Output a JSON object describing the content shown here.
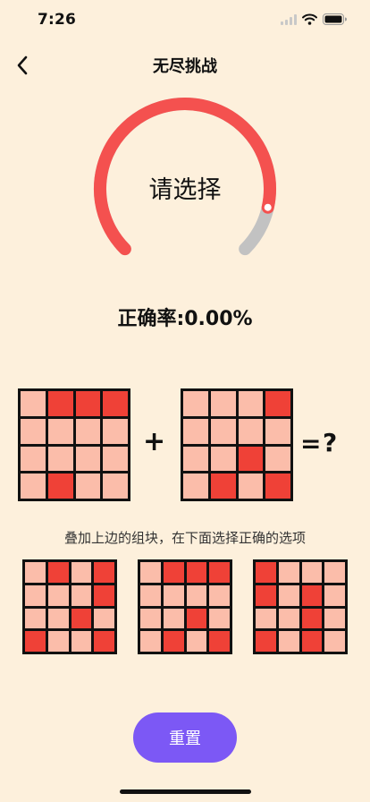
{
  "status_bar": {
    "time": "7:26",
    "icons": [
      "signal-icon",
      "wifi-icon",
      "battery-icon"
    ]
  },
  "nav": {
    "title": "无尽挑战",
    "back_icon": "chevron-left-icon"
  },
  "gauge": {
    "label": "请选择",
    "progress": 0.88,
    "colors": {
      "active": "#f4514f",
      "track": "#c2c2c2"
    }
  },
  "accuracy": {
    "text": "正确率:0.00%"
  },
  "puzzle": {
    "operand_a": [
      [
        0,
        1,
        1,
        1
      ],
      [
        0,
        0,
        0,
        0
      ],
      [
        0,
        0,
        0,
        0
      ],
      [
        0,
        1,
        0,
        0
      ]
    ],
    "plus": "+",
    "operand_b": [
      [
        0,
        0,
        0,
        1
      ],
      [
        0,
        0,
        0,
        0
      ],
      [
        0,
        0,
        1,
        0
      ],
      [
        0,
        1,
        0,
        1
      ]
    ],
    "equals": "=",
    "question": "?"
  },
  "hint": "叠加上边的组块，在下面选择正确的选项",
  "options": [
    [
      [
        0,
        1,
        0,
        1
      ],
      [
        0,
        0,
        0,
        1
      ],
      [
        0,
        0,
        1,
        0
      ],
      [
        1,
        0,
        0,
        1
      ]
    ],
    [
      [
        0,
        1,
        1,
        1
      ],
      [
        0,
        0,
        0,
        0
      ],
      [
        0,
        0,
        1,
        0
      ],
      [
        0,
        1,
        0,
        1
      ]
    ],
    [
      [
        1,
        0,
        0,
        0
      ],
      [
        1,
        0,
        1,
        0
      ],
      [
        0,
        0,
        1,
        0
      ],
      [
        1,
        0,
        1,
        0
      ]
    ]
  ],
  "reset_button": "重置",
  "colors": {
    "background": "#fdf0dc",
    "cell_on": "#ef4137",
    "cell_off": "#fbbdaa",
    "button": "#7c58f5"
  }
}
